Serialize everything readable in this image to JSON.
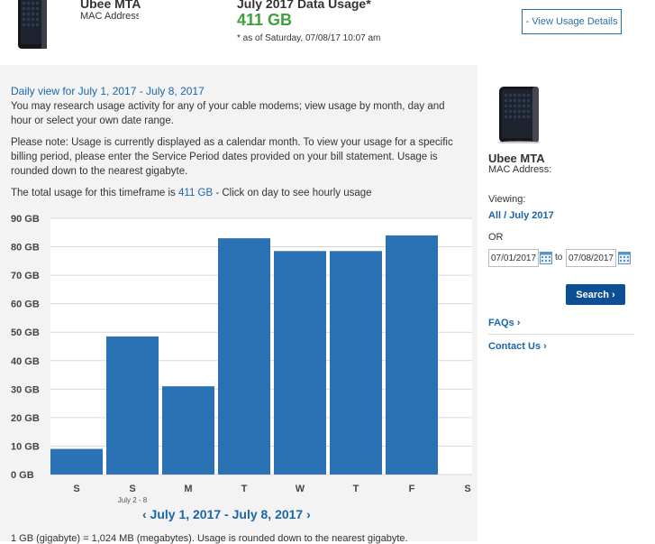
{
  "header": {
    "modem_name": "Ubee MTA",
    "mac_label": "MAC Address:",
    "usage_title": "July 2017 Data Usage*",
    "usage_total": "411 GB",
    "as_of": "* as of Saturday, 07/08/17 10:07 am",
    "view_details_label": "- View Usage Details"
  },
  "content": {
    "heading": "Daily view for July 1, 2017 - July 8, 2017",
    "para1": "You may research usage activity for any of your cable modems; view usage by month, day and hour or select your own date range.",
    "para2": "Please note: Usage is currently displayed as a calendar month. To view your usage for a specific billing period, please enter the Service Period dates provided on your bill statement. Usage is rounded down to the nearest gigabyte.",
    "total_prefix": "The total usage for this timeframe is ",
    "total_link": "411 GB",
    "total_suffix": " - Click on day to see hourly usage",
    "date_range_nav": "‹ July 1, 2017 - July 8, 2017 ›",
    "footnote": "1 GB (gigabyte) = 1,024 MB (megabytes). Usage is rounded down to the nearest gigabyte."
  },
  "chart_data": {
    "type": "bar",
    "categories": [
      "S",
      "S",
      "M",
      "T",
      "W",
      "T",
      "F",
      "S"
    ],
    "sublabels": [
      "",
      "July 2 - 8",
      "",
      "",
      "",
      "",
      "",
      ""
    ],
    "values": [
      9,
      48.5,
      31,
      83,
      78.5,
      78.5,
      84,
      0
    ],
    "ylim": [
      0,
      90
    ],
    "yticks": [
      "0 GB",
      "10 GB",
      "20 GB",
      "30 GB",
      "40 GB",
      "50 GB",
      "60 GB",
      "70 GB",
      "80 GB",
      "90 GB"
    ],
    "grid": true,
    "bar_color": "#2b72b5"
  },
  "sidebar": {
    "modem_name": "Ubee MTA",
    "mac_label": "MAC Address:",
    "viewing_label": "Viewing:",
    "period": "All / July 2017",
    "or_label": "OR",
    "date_from": "07/01/2017",
    "to_label": "to",
    "date_to": "07/08/2017",
    "search_label": "Search ›",
    "faqs_label": "FAQs ›",
    "contact_label": "Contact Us ›"
  },
  "colors": {
    "accent": "#1a66a8",
    "usage_green": "#3ea03e",
    "search_button": "#0d4f94"
  }
}
